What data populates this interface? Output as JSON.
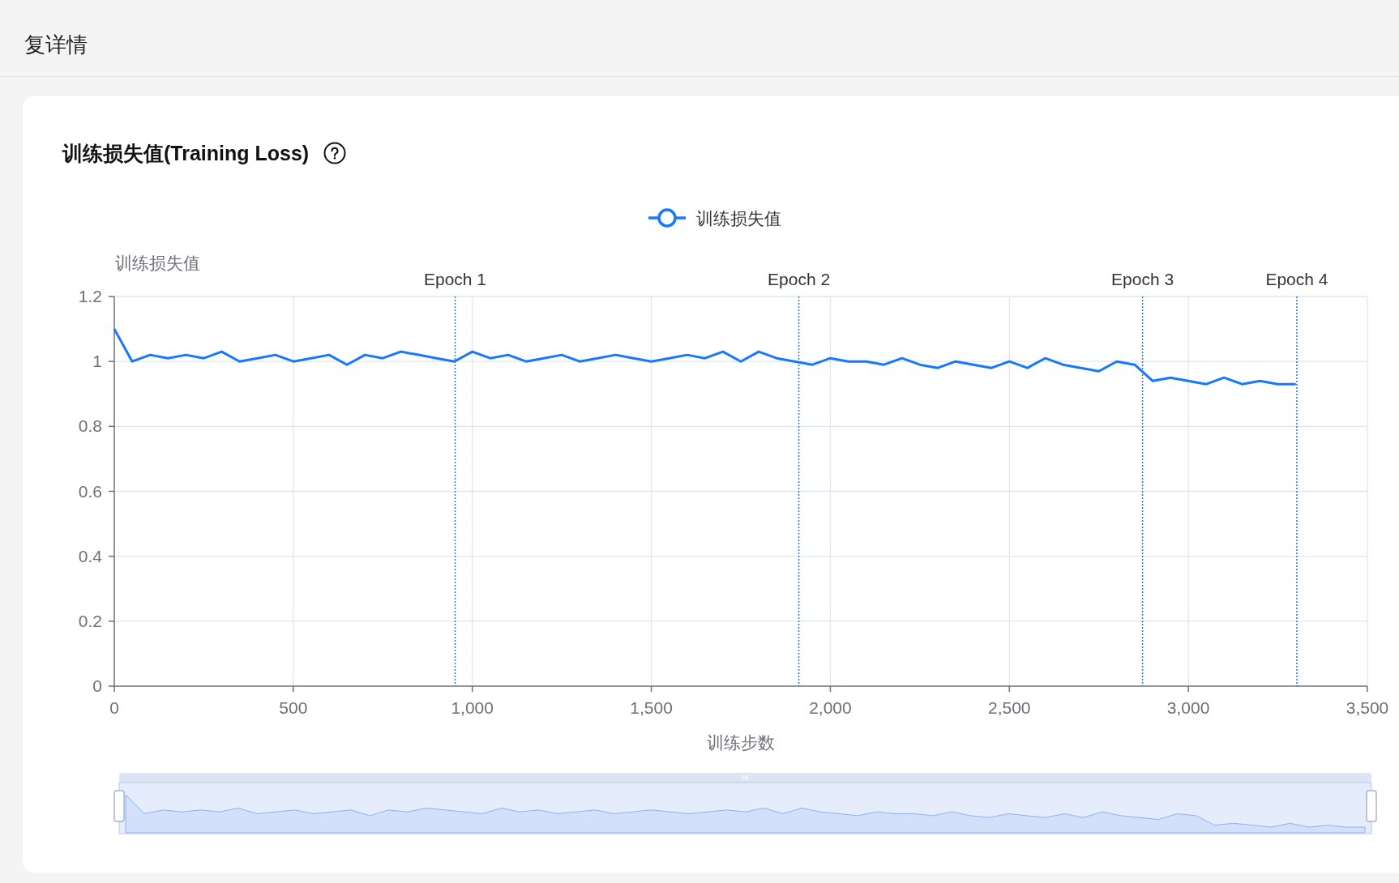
{
  "header": {
    "title": "复详情"
  },
  "card": {
    "title": "训练损失值(Training Loss)",
    "chart_data": {
      "type": "line",
      "xlabel": "训练步数",
      "ylabel": "训练损失值",
      "x": [
        0,
        50,
        100,
        150,
        200,
        250,
        300,
        350,
        400,
        450,
        500,
        550,
        600,
        650,
        700,
        750,
        800,
        850,
        900,
        950,
        1000,
        1050,
        1100,
        1150,
        1200,
        1250,
        1300,
        1350,
        1400,
        1450,
        1500,
        1550,
        1600,
        1650,
        1700,
        1750,
        1800,
        1850,
        1900,
        1950,
        2000,
        2050,
        2100,
        2150,
        2200,
        2250,
        2300,
        2350,
        2400,
        2450,
        2500,
        2550,
        2600,
        2650,
        2700,
        2750,
        2800,
        2850,
        2900,
        2950,
        3000,
        3050,
        3100,
        3150,
        3200,
        3250,
        3300
      ],
      "series": [
        {
          "name": "训练损失值",
          "color": "#1677ff",
          "values": [
            1.1,
            1.0,
            1.02,
            1.01,
            1.02,
            1.01,
            1.03,
            1.0,
            1.01,
            1.02,
            1.0,
            1.01,
            1.02,
            0.99,
            1.02,
            1.01,
            1.03,
            1.02,
            1.01,
            1.0,
            1.03,
            1.01,
            1.02,
            1.0,
            1.01,
            1.02,
            1.0,
            1.01,
            1.02,
            1.01,
            1.0,
            1.01,
            1.02,
            1.01,
            1.03,
            1.0,
            1.03,
            1.01,
            1.0,
            0.99,
            1.01,
            1.0,
            1.0,
            0.99,
            1.01,
            0.99,
            0.98,
            1.0,
            0.99,
            0.98,
            1.0,
            0.98,
            1.01,
            0.99,
            0.98,
            0.97,
            1.0,
            0.99,
            0.94,
            0.95,
            0.94,
            0.93,
            0.95,
            0.93,
            0.94,
            0.93,
            0.93
          ]
        }
      ],
      "xlim": [
        0,
        3500
      ],
      "ylim": [
        0,
        1.2
      ],
      "xticks": [
        0,
        500,
        {
          "value": 1000,
          "label": "1,000"
        },
        {
          "value": 1500,
          "label": "1,500"
        },
        {
          "value": 2000,
          "label": "2,000"
        },
        {
          "value": 2500,
          "label": "2,500"
        },
        {
          "value": 3000,
          "label": "3,000"
        },
        {
          "value": 3500,
          "label": "3,500"
        }
      ],
      "yticks": [
        0,
        0.2,
        0.4,
        0.6,
        0.8,
        1,
        1.2
      ],
      "grid": true,
      "ref_lines": [
        {
          "axis": "x",
          "value": 952,
          "label": "Epoch 1"
        },
        {
          "axis": "x",
          "value": 1912,
          "label": "Epoch 2"
        },
        {
          "axis": "x",
          "value": 2872,
          "label": "Epoch 3"
        },
        {
          "axis": "x",
          "value": 3303,
          "label": "Epoch 4"
        }
      ]
    }
  }
}
